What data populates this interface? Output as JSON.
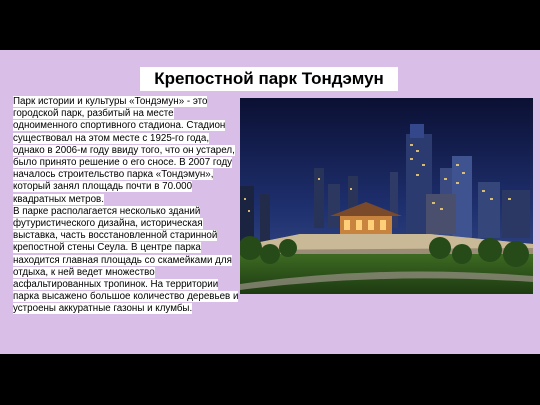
{
  "slide": {
    "title": "Крепостной парк Тондэмун",
    "paragraphs": [
      "Парк истории и культуры «Тондэмун» - это городской парк, разбитый на месте одноименного спортивного стадиона. Стадион существовал на этом месте с 1925-го года, однако в 2006-м году ввиду того, что он устарел, было принято решение о его сносе. В 2007 году началось строительство парка «Тондэмун», который занял площадь почти в 70.000 квадратных метров.",
      "В парке располагается несколько зданий футуристического дизайна, историческая выставка, часть восстановленной старинной крепостной стены Сеула. В центре парка находится главная площадь со скамейками для отдыха, к ней ведет множество асфальтированных тропинок. На территории парка высажено большое количество деревьев и устроены аккуратные газоны и клумбы."
    ]
  },
  "colors": {
    "slide_background": "#d9bfe8",
    "letterbox": "#000000",
    "text_highlight": "#ffffff"
  }
}
